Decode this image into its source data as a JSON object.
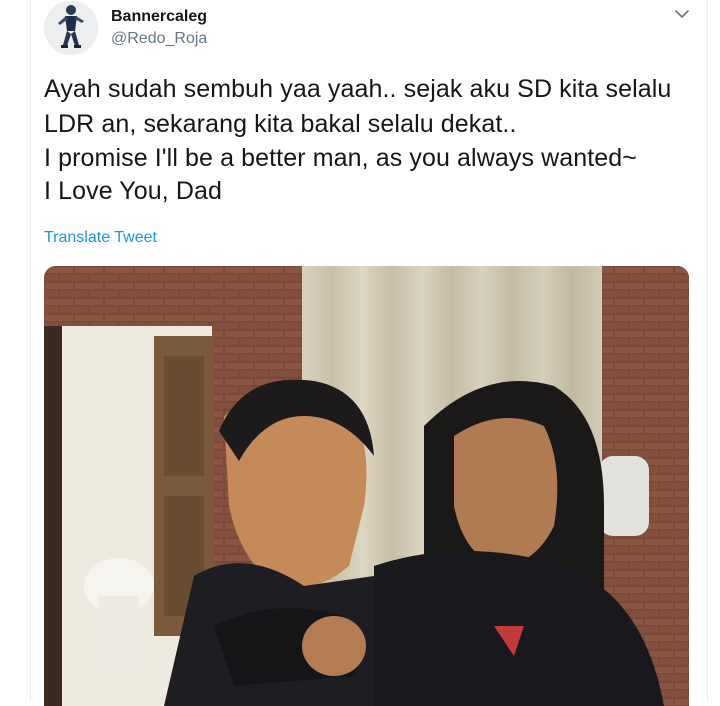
{
  "user": {
    "display_name": "Bannercaleg",
    "handle": "@Redo_Roja"
  },
  "tweet": {
    "lines": [
      "Ayah sudah sembuh yaa yaah.. sejak aku SD kita selalu",
      "LDR an, sekarang kita bakal selalu dekat..",
      "I promise I'll be a better man, as you always wanted~",
      "I Love You, Dad"
    ],
    "translate_label": "Translate Tweet"
  },
  "icons": {
    "menu": "chevron-down-icon"
  },
  "colors": {
    "link": "#1b95e0",
    "secondary_text": "#657786",
    "border": "#e6ecf0"
  }
}
